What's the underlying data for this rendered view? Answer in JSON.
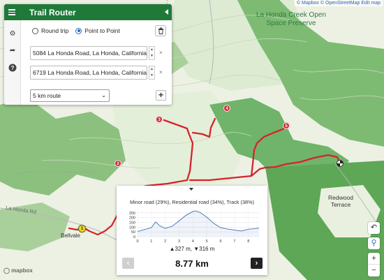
{
  "panel": {
    "title": "Trail Router",
    "modes": {
      "round_trip": "Round trip",
      "point_to_point": "Point to Point",
      "selected": "point_to_point"
    },
    "waypoints": [
      {
        "value": "5084 La Honda Road, La Honda, California"
      },
      {
        "value": "6719 La Honda Road, La Honda, California"
      }
    ],
    "route_length": {
      "selected": "5 km route"
    },
    "add_symbol": "+"
  },
  "map": {
    "attribution": {
      "mapbox": "© Mapbox",
      "osm": "© OpenStreetMap",
      "edit": "Edit map"
    },
    "labels": {
      "preserve": "La Honda Creek Open Space Preserve",
      "redwood": "Redwood Terrace",
      "bellvale": "Bellvale",
      "la_honda_rd": "La Honda Rd"
    },
    "markers": [
      "1",
      "2",
      "3",
      "4",
      "5"
    ],
    "logo": "mapbox",
    "colors": {
      "route": "#d6232e",
      "forest": "#6fb46a",
      "meadow": "#dcebd2",
      "panel_header": "#1f7a3a"
    }
  },
  "elevation": {
    "summary": "Minor road (29%), Residential road (34%), Track (38%)",
    "climb": "▲327 m, ▼316 m",
    "distance": "8.77 km",
    "prev_symbol": "‹",
    "next_symbol": "›"
  },
  "chart_data": {
    "type": "area",
    "title": "",
    "xlabel": "",
    "ylabel": "",
    "xlim": [
      0,
      8.77
    ],
    "ylim": [
      0,
      300
    ],
    "x_ticks": [
      0,
      1,
      2,
      3,
      4,
      5,
      6,
      7,
      8
    ],
    "y_ticks": [
      0,
      50,
      100,
      150,
      200,
      250
    ],
    "series": [
      {
        "x": [
          0,
          0.5,
          1.0,
          1.3,
          1.6,
          2.0,
          2.5,
          3.0,
          3.5,
          4.0,
          4.2,
          4.5,
          5.0,
          5.5,
          6.0,
          6.5,
          7.0,
          7.5,
          8.0,
          8.5,
          8.77
        ],
        "values": [
          55,
          75,
          95,
          155,
          115,
          88,
          110,
          165,
          225,
          265,
          270,
          255,
          205,
          140,
          95,
          80,
          70,
          60,
          78,
          85,
          90
        ]
      }
    ]
  }
}
